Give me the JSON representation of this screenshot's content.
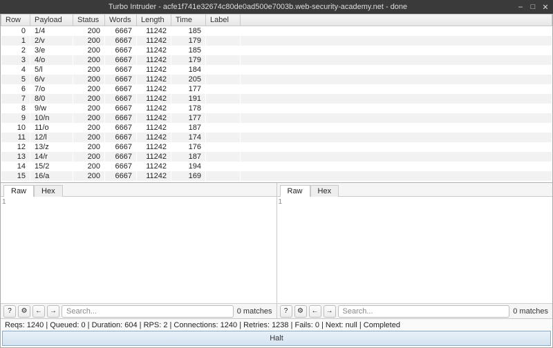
{
  "window": {
    "title": "Turbo Intruder - acfe1f741e32674c80de0ad500e7003b.web-security-academy.net - done"
  },
  "table": {
    "headers": [
      "Row",
      "Payload",
      "Status",
      "Words",
      "Length",
      "Time",
      "Label"
    ],
    "rows": [
      {
        "row": 0,
        "payload": "1/4",
        "status": 200,
        "words": 6667,
        "length": 11242,
        "time": 185
      },
      {
        "row": 1,
        "payload": "2/v",
        "status": 200,
        "words": 6667,
        "length": 11242,
        "time": 179
      },
      {
        "row": 2,
        "payload": "3/e",
        "status": 200,
        "words": 6667,
        "length": 11242,
        "time": 185
      },
      {
        "row": 3,
        "payload": "4/o",
        "status": 200,
        "words": 6667,
        "length": 11242,
        "time": 179
      },
      {
        "row": 4,
        "payload": "5/l",
        "status": 200,
        "words": 6667,
        "length": 11242,
        "time": 184
      },
      {
        "row": 5,
        "payload": "6/v",
        "status": 200,
        "words": 6667,
        "length": 11242,
        "time": 205
      },
      {
        "row": 6,
        "payload": "7/o",
        "status": 200,
        "words": 6667,
        "length": 11242,
        "time": 177
      },
      {
        "row": 7,
        "payload": "8/0",
        "status": 200,
        "words": 6667,
        "length": 11242,
        "time": 191
      },
      {
        "row": 8,
        "payload": "9/w",
        "status": 200,
        "words": 6667,
        "length": 11242,
        "time": 178
      },
      {
        "row": 9,
        "payload": "10/n",
        "status": 200,
        "words": 6667,
        "length": 11242,
        "time": 177
      },
      {
        "row": 10,
        "payload": "11/o",
        "status": 200,
        "words": 6667,
        "length": 11242,
        "time": 187
      },
      {
        "row": 11,
        "payload": "12/l",
        "status": 200,
        "words": 6667,
        "length": 11242,
        "time": 174
      },
      {
        "row": 12,
        "payload": "13/z",
        "status": 200,
        "words": 6667,
        "length": 11242,
        "time": 176
      },
      {
        "row": 13,
        "payload": "14/r",
        "status": 200,
        "words": 6667,
        "length": 11242,
        "time": 187
      },
      {
        "row": 14,
        "payload": "15/2",
        "status": 200,
        "words": 6667,
        "length": 11242,
        "time": 194
      },
      {
        "row": 15,
        "payload": "16/a",
        "status": 200,
        "words": 6667,
        "length": 11242,
        "time": 169
      }
    ]
  },
  "pane": {
    "tabs": {
      "raw": "Raw",
      "hex": "Hex"
    },
    "line_number": "1",
    "search_placeholder": "Search...",
    "match_text": "0 matches"
  },
  "status": {
    "text": "Reqs: 1240 | Queued: 0 | Duration: 604 | RPS: 2 | Connections: 1240 | Retries: 1238 | Fails: 0 | Next: null | Completed"
  },
  "halt": {
    "label": "Halt"
  },
  "icons": {
    "help": "?",
    "gear": "⚙",
    "left": "←",
    "right": "→",
    "min": "–",
    "max": "□",
    "close": "✕"
  }
}
